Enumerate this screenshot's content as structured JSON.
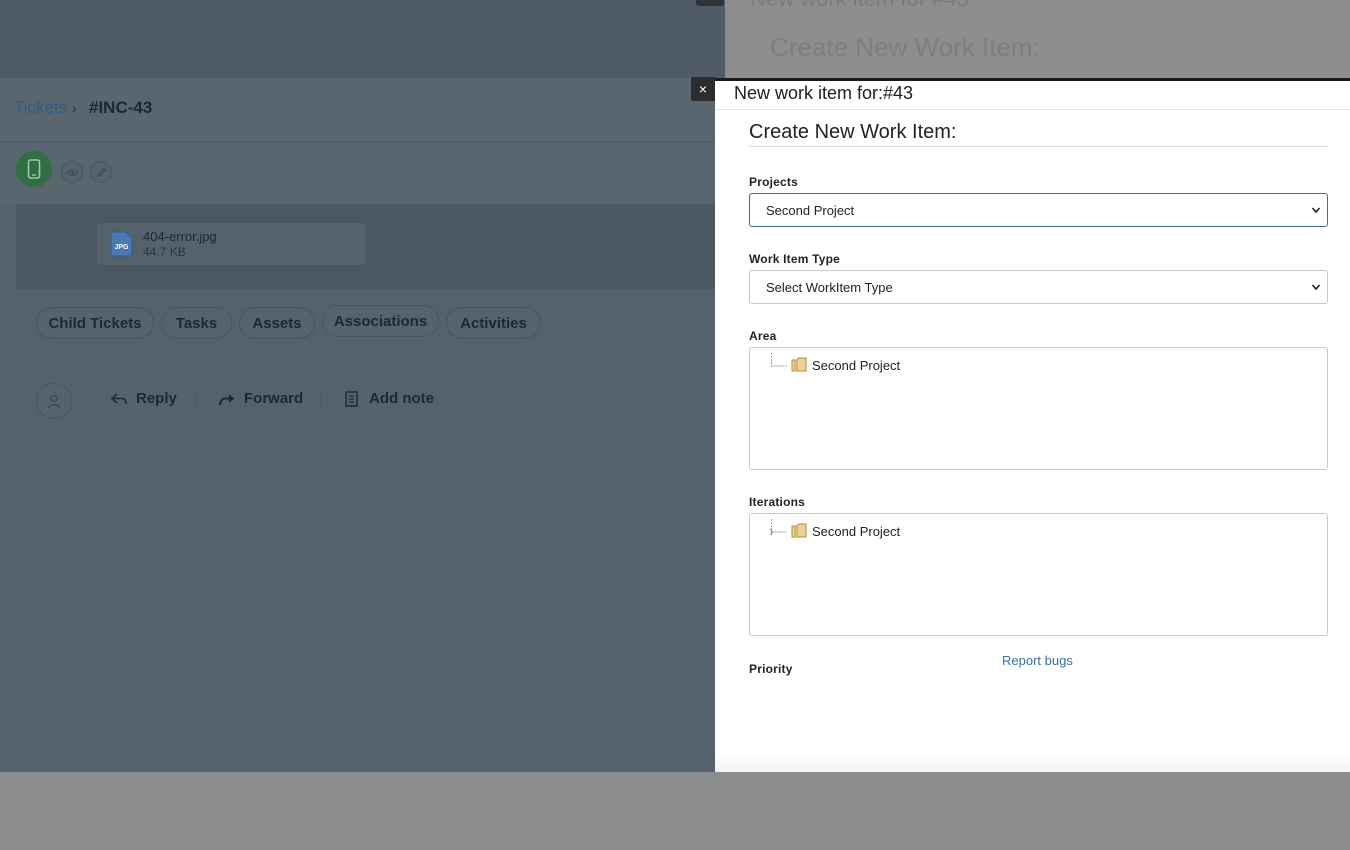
{
  "background": {
    "ghost_title": "New work item for #43",
    "ghost_heading": "Create New Work Item:",
    "breadcrumb": {
      "root": "Tickets",
      "current": "#INC-43"
    },
    "attachment": {
      "name": "404-error.jpg",
      "size": "44.7 KB",
      "type_icon": "jpg-file-icon"
    },
    "tabs": [
      "Child Tickets",
      "Tasks",
      "Assets",
      "Associations",
      "Activities"
    ],
    "actions": {
      "reply": "Reply",
      "forward": "Forward",
      "add_note": "Add note"
    }
  },
  "modal": {
    "title": "New work item for:#43",
    "close_glyph": "×",
    "heading": "Create New Work Item:",
    "fields": {
      "projects_label": "Projects",
      "projects_value": "Second Project",
      "type_label": "Work Item Type",
      "type_value": "Select WorkItem Type",
      "area_label": "Area",
      "area_node": "Second Project",
      "iterations_label": "Iterations",
      "iterations_node": "Second Project",
      "priority_label": "Priority"
    },
    "report_link": "Report bugs"
  },
  "colors": {
    "link": "#3b6ea8",
    "overlay": "#55616c",
    "avatar": "#2f6f43"
  }
}
